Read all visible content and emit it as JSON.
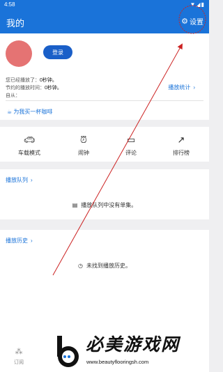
{
  "status_bar": {
    "time": "4:58",
    "system_icons": "▼◢▮"
  },
  "app_bar": {
    "title": "我的",
    "settings_label": "设置",
    "settings_icon": "gear-icon"
  },
  "profile": {
    "login_label": "登录",
    "stats_line1_prefix": "您已经播放了：",
    "stats_line1_value": "0秒钟。",
    "stats_line2_prefix": "节约的播放时间：",
    "stats_line2_value": "0秒钟。",
    "stats_line3": "自从：",
    "stats_link": "播放统计",
    "coffee_label": "为我买一杯咖啡"
  },
  "modes": [
    {
      "label": "车载模式",
      "icon": "car-icon"
    },
    {
      "label": "闹钟",
      "icon": "alarm-clock-icon"
    },
    {
      "label": "评论",
      "icon": "comment-icon"
    },
    {
      "label": "排行榜",
      "icon": "trending-icon"
    }
  ],
  "queue": {
    "title": "播放队列",
    "empty_text": "播放队列中没有单集。"
  },
  "history": {
    "title": "播放历史",
    "empty_text": "未找到播放历史。"
  },
  "bottom_nav": {
    "subscriptions_label": "订阅"
  },
  "watermark": {
    "title": "必美游戏网",
    "url": "www.beautyflooringsh.com"
  },
  "colors": {
    "primary": "#1a73d9",
    "avatar": "#e57373",
    "annotation": "#cc2222"
  }
}
